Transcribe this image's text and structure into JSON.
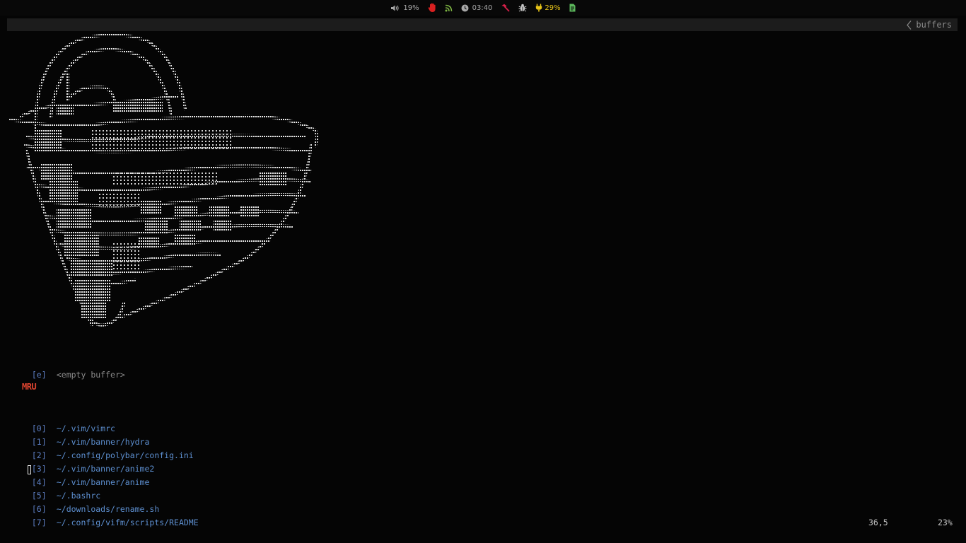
{
  "topbar": {
    "volume": "19%",
    "clock": "03:40",
    "battery": "29%"
  },
  "tabline": {
    "label": "buffers"
  },
  "startify": {
    "empty": {
      "index": "[e]",
      "label": "<empty buffer>"
    },
    "mru_header": "MRU",
    "mru": [
      {
        "index": "[0]",
        "path": "~/.vim/vimrc"
      },
      {
        "index": "[1]",
        "path": "~/.vim/banner/hydra"
      },
      {
        "index": "[2]",
        "path": "~/.config/polybar/config.ini"
      },
      {
        "index": "[3]",
        "path": "~/.vim/banner/anime2"
      },
      {
        "index": "[4]",
        "path": "~/.vim/banner/anime"
      },
      {
        "index": "[5]",
        "path": "~/.bashrc"
      },
      {
        "index": "[6]",
        "path": "~/downloads/rename.sh"
      },
      {
        "index": "[7]",
        "path": "~/.config/vifm/scripts/README"
      }
    ]
  },
  "ruler": {
    "position": "36,5",
    "percent": "23%"
  },
  "colors": {
    "background": "#050505",
    "index": "#5d7fc4",
    "path": "#5d8fd0",
    "mru_header": "#e04530",
    "tabline": "#1c1c1c"
  }
}
